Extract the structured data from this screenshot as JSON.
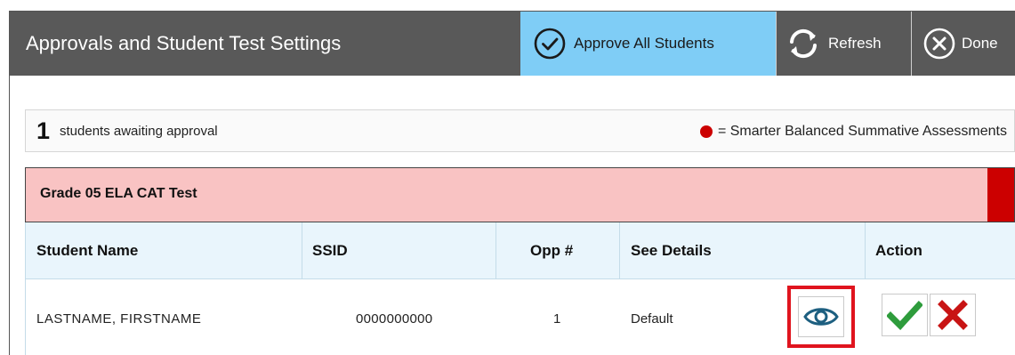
{
  "header": {
    "title": "Approvals and Student Test Settings",
    "approve_all_label": "Approve All Students",
    "refresh_label": "Refresh",
    "done_label": "Done"
  },
  "summary": {
    "count": "1",
    "text": "students awaiting approval",
    "legend_text": "= Smarter Balanced Summative Assessments",
    "legend_color": "#cc0000"
  },
  "test": {
    "name": "Grade 05 ELA CAT Test",
    "marker_color": "#cc0000",
    "columns": {
      "student_name": "Student Name",
      "ssid": "SSID",
      "opp": "Opp #",
      "see_details": "See Details",
      "action": "Action"
    },
    "rows": [
      {
        "student_name": "LASTNAME, FIRSTNAME",
        "ssid": "0000000000",
        "opp": "1",
        "details": "Default"
      }
    ]
  },
  "colors": {
    "header_bg": "#595959",
    "approve_bg": "#7fcdf6",
    "test_header_bg": "#f9c3c3",
    "col_header_bg": "#e9f5fc",
    "approve_check": "#2e9c3c",
    "deny_x": "#c81414",
    "view_highlight": "#e0141e"
  },
  "icons": {
    "approve_all": "check-circle-icon",
    "refresh": "refresh-icon",
    "done": "close-circle-icon",
    "view": "eye-icon",
    "approve": "check-icon",
    "deny": "x-icon"
  }
}
